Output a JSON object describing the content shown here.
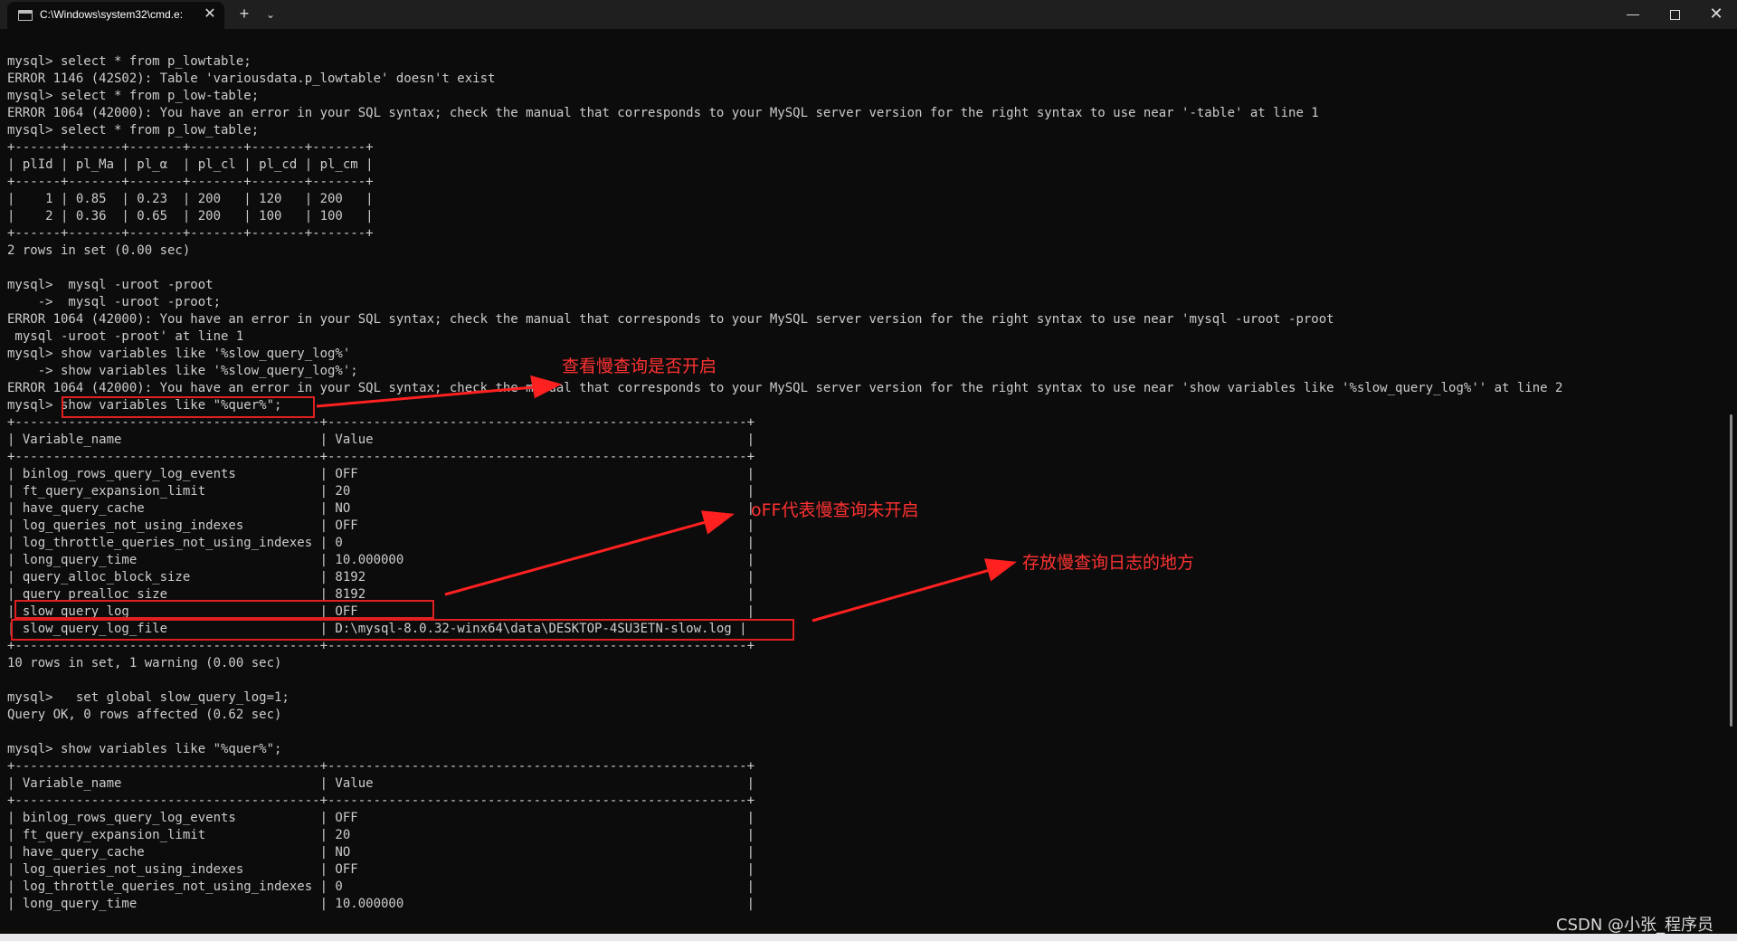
{
  "window": {
    "tab_title": "C:\\Windows\\system32\\cmd.e:",
    "close_tab_glyph": "✕",
    "new_tab_glyph": "+",
    "dropdown_glyph": "⌄",
    "minimize_glyph": "—",
    "close_glyph": "✕"
  },
  "terminal": {
    "lines": [
      "mysql> select * from p_lowtable;",
      "ERROR 1146 (42S02): Table 'variousdata.p_lowtable' doesn't exist",
      "mysql> select * from p_low-table;",
      "ERROR 1064 (42000): You have an error in your SQL syntax; check the manual that corresponds to your MySQL server version for the right syntax to use near '-table' at line 1",
      "mysql> select * from p_low_table;",
      "+------+-------+-------+-------+-------+-------+",
      "| plId | pl_Ma | pl_α  | pl_cl | pl_cd | pl_cm |",
      "+------+-------+-------+-------+-------+-------+",
      "|    1 | 0.85  | 0.23  | 200   | 120   | 200   |",
      "|    2 | 0.36  | 0.65  | 200   | 100   | 100   |",
      "+------+-------+-------+-------+-------+-------+",
      "2 rows in set (0.00 sec)",
      "",
      "mysql>  mysql -uroot -proot",
      "    ->  mysql -uroot -proot;",
      "ERROR 1064 (42000): You have an error in your SQL syntax; check the manual that corresponds to your MySQL server version for the right syntax to use near 'mysql -uroot -proot",
      " mysql -uroot -proot' at line 1",
      "mysql> show variables like '%slow_query_log%'",
      "    -> show variables like '%slow_query_log%';",
      "ERROR 1064 (42000): You have an error in your SQL syntax; check the manual that corresponds to your MySQL server version for the right syntax to use near 'show variables like '%slow_query_log%'' at line 2",
      "mysql> show variables like \"%quer%\";",
      "+----------------------------------------+-------------------------------------------------------+",
      "| Variable_name                          | Value                                                 |",
      "+----------------------------------------+-------------------------------------------------------+",
      "| binlog_rows_query_log_events           | OFF                                                   |",
      "| ft_query_expansion_limit               | 20                                                    |",
      "| have_query_cache                       | NO                                                    |",
      "| log_queries_not_using_indexes          | OFF                                                   |",
      "| log_throttle_queries_not_using_indexes | 0                                                     |",
      "| long_query_time                        | 10.000000                                             |",
      "| query_alloc_block_size                 | 8192                                                  |",
      "| query_prealloc_size                    | 8192                                                  |",
      "| slow_query_log                         | OFF                                                   |",
      "| slow_query_log_file                    | D:\\mysql-8.0.32-winx64\\data\\DESKTOP-4SU3ETN-slow.log |",
      "+----------------------------------------+-------------------------------------------------------+",
      "10 rows in set, 1 warning (0.00 sec)",
      "",
      "mysql>   set global slow_query_log=1;",
      "Query OK, 0 rows affected (0.62 sec)",
      "",
      "mysql> show variables like \"%quer%\";",
      "+----------------------------------------+-------------------------------------------------------+",
      "| Variable_name                          | Value                                                 |",
      "+----------------------------------------+-------------------------------------------------------+",
      "| binlog_rows_query_log_events           | OFF                                                   |",
      "| ft_query_expansion_limit               | 20                                                    |",
      "| have_query_cache                       | NO                                                    |",
      "| log_queries_not_using_indexes          | OFF                                                   |",
      "| log_throttle_queries_not_using_indexes | 0                                                     |",
      "| long_query_time                        | 10.000000                                             |"
    ]
  },
  "annotations": {
    "check_slow_query": "查看慢查询是否开启",
    "off_meaning": "oFF代表慢查询未开启",
    "log_location": "存放慢查询日志的地方",
    "color": "#ff3232"
  },
  "watermark": "CSDN @小张_程序员"
}
